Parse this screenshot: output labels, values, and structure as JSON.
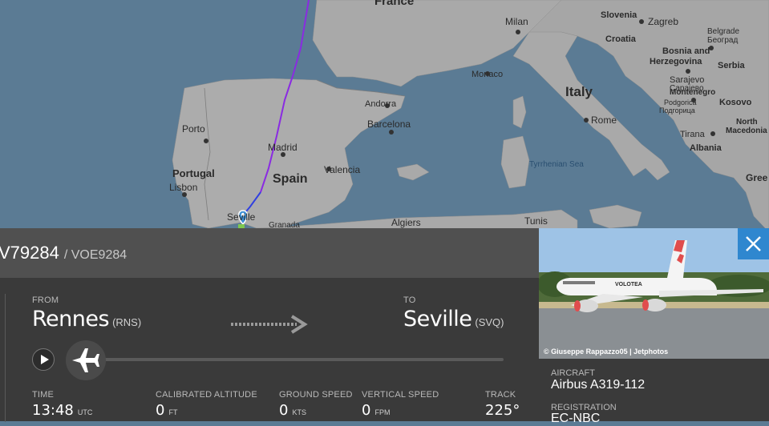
{
  "map": {
    "countries": [
      "France",
      "Spain",
      "Portugal",
      "Italy",
      "Slovenia",
      "Croatia",
      "Bosnia and",
      "Herzegovina",
      "Serbia",
      "Montenegro",
      "Kosovo",
      "Albania",
      "North",
      "Macedonia",
      "Gree"
    ],
    "cities": [
      "Zagreb",
      "Belgrade",
      "Београд",
      "Sarajevo",
      "Сарајево",
      "Podgorica",
      "Подгорица",
      "Tirana",
      "Milan",
      "Monaco",
      "Rome",
      "Andorra",
      "Barcelona",
      "Madrid",
      "Valencia",
      "Porto",
      "Lisbon",
      "Seville",
      "Granada",
      "Algiers",
      "Tunis"
    ],
    "seas": [
      "Tyrrhenian Sea"
    ]
  },
  "flight": {
    "callsign": "V79284",
    "alt_callsign": "/ VOE9284"
  },
  "route": {
    "from_label": "FROM",
    "from_city": "Rennes",
    "from_code": "(RNS)",
    "to_label": "TO",
    "to_city": "Seville",
    "to_code": "(SVQ)"
  },
  "stats": {
    "time_label": "TIME",
    "time_value": "13:48",
    "time_unit": "UTC",
    "alt_label": "CALIBRATED ALTITUDE",
    "alt_value": "0",
    "alt_unit": "FT",
    "gs_label": "GROUND SPEED",
    "gs_value": "0",
    "gs_unit": "KTS",
    "vs_label": "VERTICAL SPEED",
    "vs_value": "0",
    "vs_unit": "FPM",
    "track_label": "TRACK",
    "track_value": "225°"
  },
  "photo": {
    "credit": "© Giuseppe Rappazzo05 | Jetphotos",
    "livery_text": "VOLOTEA"
  },
  "aircraft": {
    "aircraft_label": "AIRCRAFT",
    "aircraft_value": "Airbus A319-112",
    "reg_label": "REGISTRATION",
    "reg_value": "EC-NBC"
  },
  "colors": {
    "sea": "#5b7b94",
    "land": "#aaaaaa",
    "route_purple": "#8a2be2",
    "route_blue": "#3040e0",
    "close_button": "#2f87cf"
  },
  "icons": [
    "play-icon",
    "airplane-icon",
    "close-icon",
    "arrow-right-icon",
    "map-pin-icon"
  ]
}
